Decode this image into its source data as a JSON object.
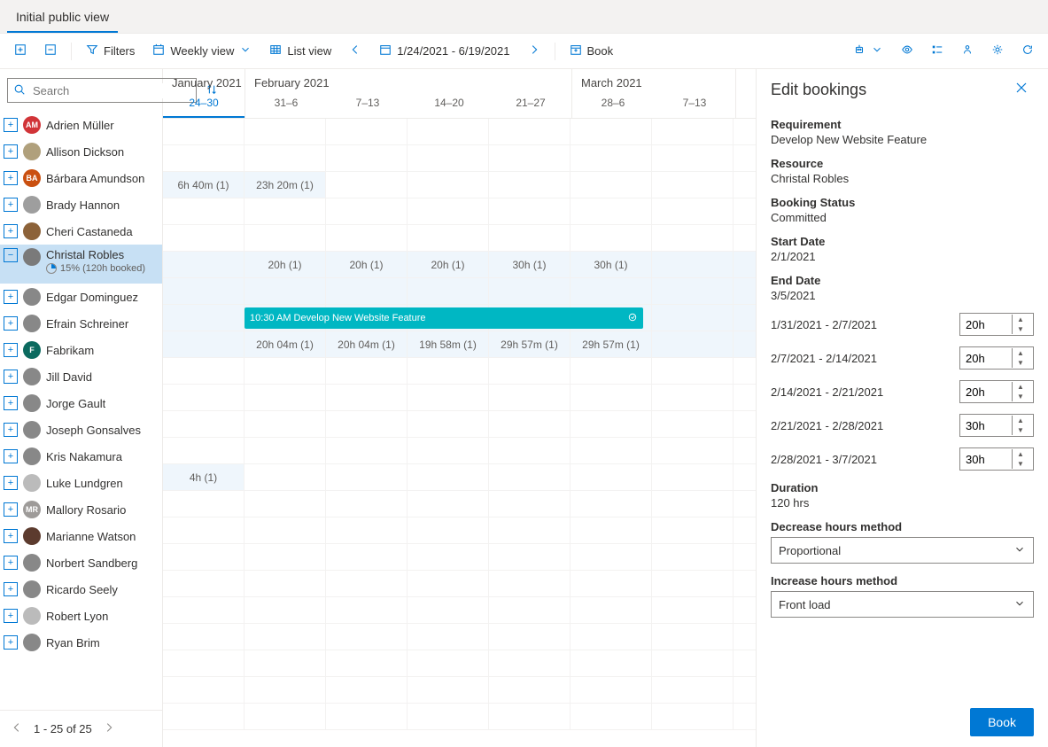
{
  "tabs": [
    "Initial public view"
  ],
  "activeTab": 0,
  "toolbar": {
    "filters": "Filters",
    "weeklyView": "Weekly view",
    "listView": "List view",
    "dateRange": "1/24/2021 - 6/19/2021",
    "book": "Book"
  },
  "search": {
    "placeholder": "Search"
  },
  "resources": [
    {
      "name": "Adrien Müller",
      "initials": "AM",
      "color": "#d13438"
    },
    {
      "name": "Allison Dickson",
      "color": "#b0a07c"
    },
    {
      "name": "Bárbara Amundson",
      "initials": "BA",
      "color": "#ca5010"
    },
    {
      "name": "Brady Hannon",
      "color": "#9e9e9e"
    },
    {
      "name": "Cheri Castaneda",
      "color": "#8c6239"
    },
    {
      "name": "Christal Robles",
      "color": "#7a7a7a",
      "selected": true,
      "utilPct": "15%",
      "utilText": "(120h booked)"
    },
    {
      "name": "Edgar Dominguez",
      "color": "#888"
    },
    {
      "name": "Efrain Schreiner",
      "color": "#888"
    },
    {
      "name": "Fabrikam",
      "initials": "F",
      "color": "#0b6a5f"
    },
    {
      "name": "Jill David",
      "color": "#888"
    },
    {
      "name": "Jorge Gault",
      "color": "#888"
    },
    {
      "name": "Joseph Gonsalves",
      "color": "#888"
    },
    {
      "name": "Kris Nakamura",
      "color": "#888"
    },
    {
      "name": "Luke Lundgren",
      "color": "#bbb"
    },
    {
      "name": "Mallory Rosario",
      "initials": "MR",
      "color": "#9e9b99"
    },
    {
      "name": "Marianne Watson",
      "color": "#5c3b2e"
    },
    {
      "name": "Norbert Sandberg",
      "color": "#888"
    },
    {
      "name": "Ricardo Seely",
      "color": "#888"
    },
    {
      "name": "Robert Lyon",
      "color": "#bbb"
    },
    {
      "name": "Ryan Brim",
      "color": "#888"
    }
  ],
  "pager": "1 - 25 of 25",
  "months": [
    {
      "label": "January 2021",
      "weeks": [
        {
          "label": "24–30",
          "active": true
        }
      ]
    },
    {
      "label": "February 2021",
      "weeks": [
        {
          "label": "31–6"
        },
        {
          "label": "7–13"
        },
        {
          "label": "14–20"
        },
        {
          "label": "21–27"
        }
      ]
    },
    {
      "label": "March 2021",
      "weeks": [
        {
          "label": "28–6"
        },
        {
          "label": "7–13"
        }
      ]
    }
  ],
  "grid": {
    "barbara": [
      "6h 40m (1)",
      "23h 20m (1)",
      "",
      "",
      "",
      "",
      ""
    ],
    "christalTop": [
      "",
      "20h (1)",
      "20h (1)",
      "20h (1)",
      "30h (1)",
      "30h (1)",
      ""
    ],
    "christalBottom": [
      "",
      "20h 04m (1)",
      "20h 04m (1)",
      "19h 58m (1)",
      "29h 57m (1)",
      "29h 57m (1)",
      ""
    ],
    "jorge": [
      "4h (1)",
      "",
      "",
      "",
      "",
      "",
      ""
    ]
  },
  "event": {
    "time": "10:30 AM",
    "title": "Develop New Website Feature"
  },
  "panel": {
    "title": "Edit bookings",
    "requirementLabel": "Requirement",
    "requirement": "Develop New Website Feature",
    "resourceLabel": "Resource",
    "resource": "Christal Robles",
    "statusLabel": "Booking Status",
    "status": "Committed",
    "startLabel": "Start Date",
    "start": "2/1/2021",
    "endLabel": "End Date",
    "end": "3/5/2021",
    "allocations": [
      {
        "range": "1/31/2021 - 2/7/2021",
        "hours": "20h"
      },
      {
        "range": "2/7/2021 - 2/14/2021",
        "hours": "20h"
      },
      {
        "range": "2/14/2021 - 2/21/2021",
        "hours": "20h"
      },
      {
        "range": "2/21/2021 - 2/28/2021",
        "hours": "30h"
      },
      {
        "range": "2/28/2021 - 3/7/2021",
        "hours": "30h"
      }
    ],
    "durationLabel": "Duration",
    "duration": "120 hrs",
    "decreaseLabel": "Decrease hours method",
    "decrease": "Proportional",
    "increaseLabel": "Increase hours method",
    "increase": "Front load",
    "bookBtn": "Book"
  }
}
